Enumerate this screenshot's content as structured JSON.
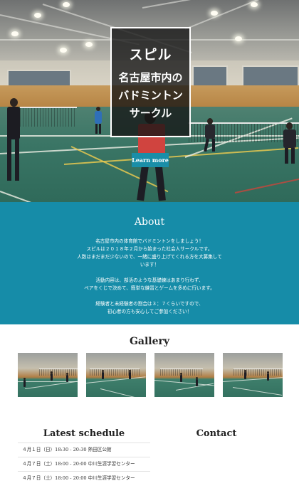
{
  "hero": {
    "title": "スピル",
    "subtitle_lines": [
      "名古屋市内の",
      "バドミントン",
      "サークル"
    ],
    "cta_label": "Learn more",
    "accent_color": "#168ca8"
  },
  "about": {
    "heading": "About",
    "paragraph1_lines": [
      "名古屋市内の体育館でバドミントンをしましょう！",
      "スピルは２０１８年２月から始まった社会人サークルです。",
      "人数はまだまだ少ないので、一緒に盛り上げてくれる方を大募集して",
      "います！"
    ],
    "paragraph2_lines": [
      "活動内容は、部活のような基礎練はあまり行わず、",
      "ペアをくじで決めて、簡単な練習とゲームを多めに行います。"
    ],
    "paragraph3_lines": [
      "経験者と未経験者の割合は３：７くらいですので、",
      "初心者の方も安心してご参加ください！"
    ]
  },
  "gallery": {
    "heading": "Gallery",
    "photos": [
      {
        "icon": "gym-photo"
      },
      {
        "icon": "gym-photo"
      },
      {
        "icon": "gym-photo"
      },
      {
        "icon": "gym-photo"
      }
    ]
  },
  "schedule": {
    "heading": "Latest schedule",
    "items": [
      "４月１日（日）18:30 - 20:30 熱田区公館",
      "４月７日（土）18:00 - 20:00 中川生涯学習センター",
      "４月７日（土）18:00 - 20:00 中川生涯学習センター"
    ]
  },
  "contact": {
    "heading": "Contact"
  }
}
